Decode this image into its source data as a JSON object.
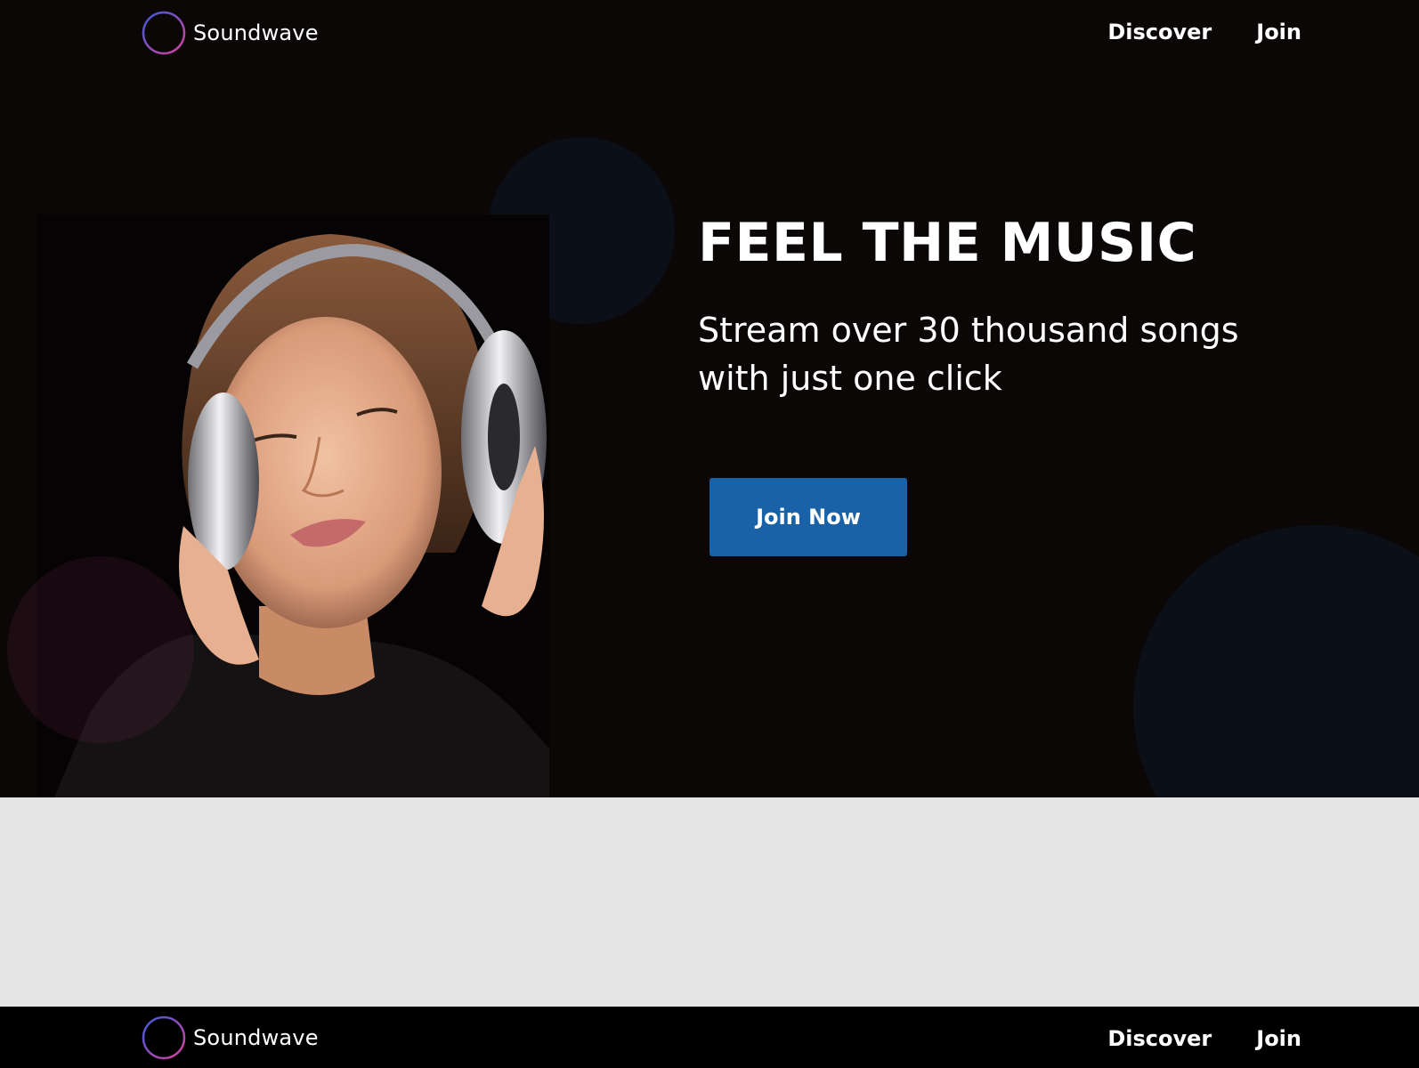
{
  "header": {
    "brand_name": "Soundwave",
    "logo_icon": "soundwave-logo-icon",
    "nav": {
      "discover_label": "Discover",
      "join_label": "Join"
    }
  },
  "hero": {
    "headline": "FEEL THE MUSIC",
    "subheadline": "Stream over 30 thousand songs with just one click",
    "cta_label": "Join Now",
    "image_subject": "woman-with-headphones-photo"
  },
  "footer": {
    "brand_name": "Soundwave",
    "nav": {
      "discover_label": "Discover",
      "join_label": "Join"
    }
  },
  "colors": {
    "hero_background": "#0b0707",
    "page_background": "#e5e5e5",
    "footer_background": "#000000",
    "cta_background": "#1a62a8",
    "text": "#ffffff",
    "logo_gradient_start": "#3b5bd6",
    "logo_gradient_end": "#d6419a"
  }
}
